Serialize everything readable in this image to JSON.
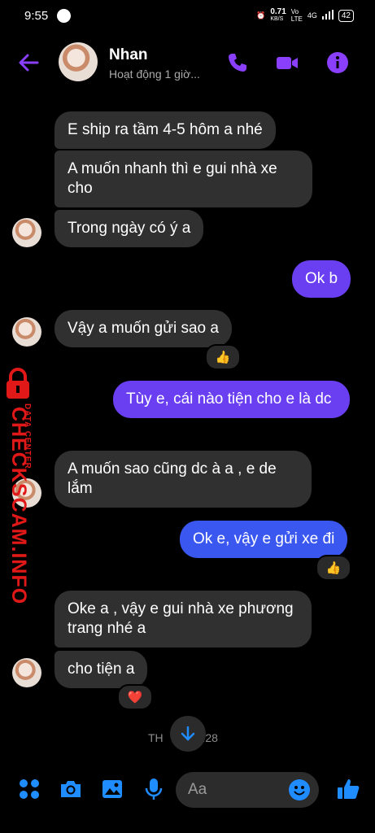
{
  "status_bar": {
    "time": "9:55",
    "speed": "0.71",
    "speed_unit": "KB/S",
    "vo": "Vo",
    "lte": "LTE",
    "network": "4G",
    "battery": "42"
  },
  "header": {
    "contact_name": "Nhan",
    "activity": "Hoạt động 1 giờ..."
  },
  "messages": [
    {
      "dir": "in",
      "text": "E ship ra tầm 4-5 hôm a nhé"
    },
    {
      "dir": "in",
      "text": "A muốn nhanh thì e gui nhà xe cho"
    },
    {
      "dir": "in",
      "text": "Trong ngày có ý a"
    },
    {
      "dir": "out",
      "text": "Ok b"
    },
    {
      "dir": "in",
      "text": "Vậy a muốn gửi sao a",
      "reaction": "👍"
    },
    {
      "dir": "out",
      "text": "Tùy e, cái nào tiện cho e là dc"
    },
    {
      "dir": "in",
      "text": "A muốn sao cũng dc à a , e de lắm"
    },
    {
      "dir": "out",
      "text": "Ok e, vậy e gửi xe đi",
      "reaction": "👍"
    },
    {
      "dir": "in",
      "text": "Oke a , vậy e gui nhà xe phương trang nhé a"
    },
    {
      "dir": "in",
      "text": "cho tiện a",
      "reaction": "❤️"
    }
  ],
  "timestamp_left": "TH",
  "timestamp_right": "9:28",
  "composer": {
    "placeholder": "Aa"
  },
  "watermark": {
    "brand": "CHECKSCAM.INFO",
    "tag": "DATA CENTER"
  },
  "colors": {
    "accent": "#8a3ffc",
    "outgoing_purple": "#6a3ff2",
    "outgoing_blue": "#3a58f0",
    "incoming": "#303030",
    "composer_icon": "#1f8cff"
  }
}
